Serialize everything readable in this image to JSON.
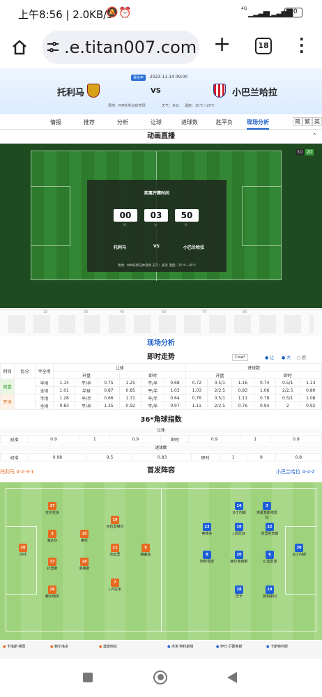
{
  "status": {
    "time": "上午8:56 | 2.0KB/s",
    "battery": "90",
    "network": "4G"
  },
  "browser": {
    "url": ".e.titan007.com",
    "tab_count": "18"
  },
  "match": {
    "league": "哥伦甲",
    "datetime": "2023-11-14 09:00",
    "home": "托利马",
    "away": "小巴兰哈拉",
    "vs": "VS",
    "info": "场地：MM托利马体育场",
    "weather": "天气：多云",
    "temp": "温度：20℃~26℃"
  },
  "tabs": [
    "情报",
    "推荐",
    "分析",
    "让球",
    "进球数",
    "胜平负",
    "现场分析"
  ],
  "tab_buttons": [
    "简",
    "繁",
    "英"
  ],
  "animation": {
    "title": "动画直播",
    "btn3d": "3D",
    "btn2d": "2D",
    "count_title": "距离开赛时间",
    "hours": "00",
    "minutes": "03",
    "seconds": "50",
    "hours_label": "时",
    "minutes_label": "分",
    "seconds_label": "秒",
    "home": "托利马",
    "away": "小巴兰哈拉",
    "vs": "VS",
    "info": "场地：MM托利马体育场 天气：多云 温度：25℃~26℃"
  },
  "ruler": [
    "15",
    "30",
    "45",
    "60",
    "75",
    "90"
  ],
  "live_analysis": {
    "title": "现场分析"
  },
  "trend": {
    "title": "即时走势",
    "company": "Crow*",
    "filters": [
      "让",
      "大",
      "欧"
    ],
    "head1": [
      "时间",
      "比分",
      "半全场",
      "让球",
      "进球数"
    ],
    "head2": [
      "开盘",
      "即时",
      "开盘",
      "即时"
    ],
    "rows": [
      [
        "半场",
        "1.14",
        "平/半",
        "0.75",
        "1.25",
        "平/半",
        "0.68",
        "0.72",
        "0.5/1",
        "1.16",
        "0.74",
        "0.5/1",
        "1.13"
      ],
      [
        "全场",
        "1.01",
        "半球",
        "0.87",
        "0.85",
        "平/半",
        "1.03",
        "1.03",
        "2/2.5",
        "0.83",
        "1.06",
        "2/2.5",
        "0.80"
      ],
      [
        "半场",
        "1.28",
        "平/半",
        "0.66",
        "1.31",
        "平/半",
        "0.64",
        "0.76",
        "0.5/1",
        "1.11",
        "0.78",
        "0.5/1",
        "1.08"
      ],
      [
        "全场",
        "0.83",
        "平/半",
        "1.35",
        "0.92",
        "平/半",
        "0.97",
        "1.11",
        "2/2.5",
        "0.76",
        "0.94",
        "2",
        "0.92"
      ]
    ],
    "row_labels": [
      "初盘",
      "开场"
    ]
  },
  "corners": {
    "title": "36*角球指数",
    "sub1": "让球",
    "sub2": "进球数",
    "row1": [
      "初指",
      "0.9",
      "1",
      "0.9",
      "即时",
      "0.9",
      "1",
      "0.9"
    ],
    "row2": [
      "初指",
      "0.98",
      "9.5",
      "0.83",
      "即时",
      "1",
      "9",
      "0.8"
    ]
  },
  "lineup": {
    "title": "首发阵容",
    "home_formation": "托利马 4-2-3-1",
    "away_formation": "小巴兰哈拉 4-4-2",
    "home_players": [
      {
        "n": "27",
        "name": "吉尔拉多"
      },
      {
        "n": "3",
        "name": "海达尔"
      },
      {
        "n": "17",
        "name": "托雷斯"
      },
      {
        "n": "26",
        "name": "赫尔南多"
      },
      {
        "n": "15",
        "name": "席托"
      },
      {
        "n": "14",
        "name": "菲奥斯"
      },
      {
        "n": "18",
        "name": "瓦拉雷维尔"
      },
      {
        "n": "11",
        "name": "吉延里"
      },
      {
        "n": "7",
        "name": "J.卢拉米"
      },
      {
        "n": "9",
        "name": "赫塞佐"
      },
      {
        "n": "30",
        "name": "内托"
      }
    ],
    "away_players": [
      {
        "n": "14",
        "name": "马丁内斯"
      },
      {
        "n": "3",
        "name": "埃蒙基斯塔雷拉"
      },
      {
        "n": "23",
        "name": "奥维多"
      },
      {
        "n": "10",
        "name": "J.佩尼亚"
      },
      {
        "n": "22",
        "name": "普里利奇斯"
      },
      {
        "n": "8",
        "name": "阿萨雷斯"
      },
      {
        "n": "20",
        "name": "赫尔南德斯"
      },
      {
        "n": "6",
        "name": "D.莫雷诺"
      },
      {
        "n": "28",
        "name": "巴卡"
      },
      {
        "n": "19",
        "name": "莫利斯内"
      },
      {
        "n": "30",
        "name": "马丁内斯"
      }
    ],
    "subs_home": [
      "卡洛斯·维雷",
      "鲍尔洛多",
      "莫斯西拉"
    ],
    "subs_away": [
      "杰米·阿科斯塔",
      "伊万·贝蒙奥斯",
      "卡斯特利斯"
    ]
  }
}
